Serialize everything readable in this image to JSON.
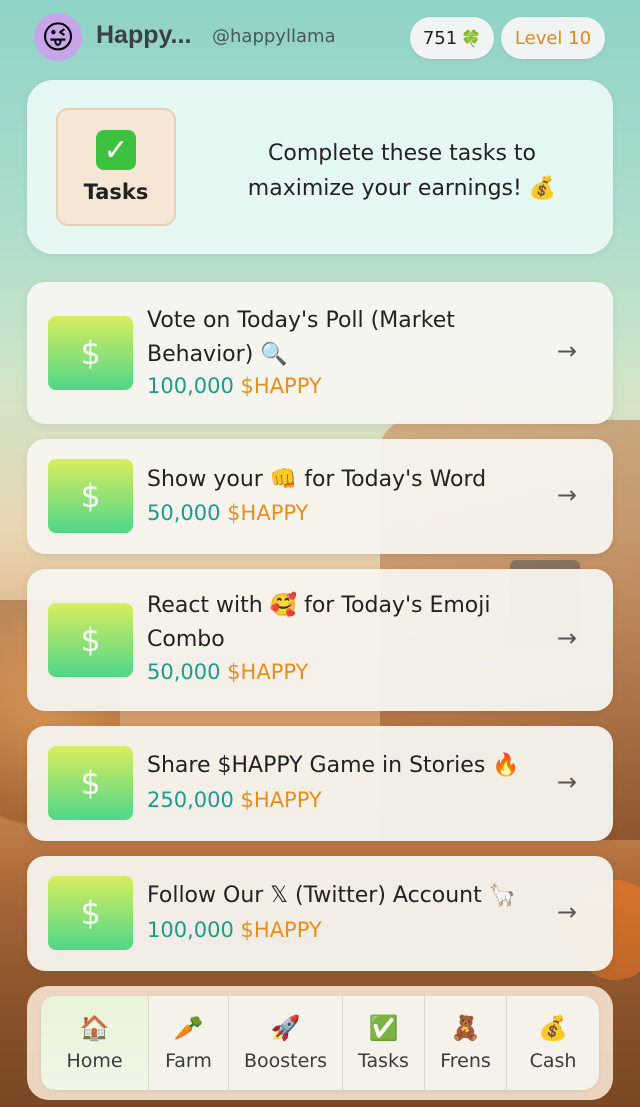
{
  "header": {
    "avatar": "😜",
    "user_name": "Happy...",
    "user_handle": "@happyllama",
    "score": "751",
    "score_icon": "🍀",
    "level": "Level 10"
  },
  "banner": {
    "badge_icon": "✓",
    "badge_label": "Tasks",
    "description": "Complete these tasks to maximize your earnings! 💰"
  },
  "tasks": [
    {
      "icon": "$",
      "title": "Vote on Today's Poll (Market Behavior) 🔍",
      "amount": "100,000",
      "currency": "$HAPPY"
    },
    {
      "icon": "$",
      "title": "Show your 👊 for Today's Word",
      "amount": "50,000",
      "currency": "$HAPPY"
    },
    {
      "icon": "$",
      "title": "React with 🥰 for Today's Emoji Combo",
      "amount": "50,000",
      "currency": "$HAPPY"
    },
    {
      "icon": "$",
      "title": "Share $HAPPY Game in Stories 🔥",
      "amount": "250,000",
      "currency": "$HAPPY"
    },
    {
      "icon": "$",
      "title": "Follow Our 𝕏 (Twitter) Account 🦙",
      "amount": "100,000",
      "currency": "$HAPPY"
    }
  ],
  "arrow": "→",
  "nav": [
    {
      "icon": "🏠",
      "label": "Home"
    },
    {
      "icon": "🥕",
      "label": "Farm"
    },
    {
      "icon": "🚀",
      "label": "Boosters"
    },
    {
      "icon": "✅",
      "label": "Tasks"
    },
    {
      "icon": "🧸",
      "label": "Frens"
    },
    {
      "icon": "💰",
      "label": "Cash"
    }
  ],
  "colors": {
    "reward_amount": "#1f9a8d",
    "reward_currency": "#e98e1a",
    "level": "#e08a1e",
    "task_icon_top": "#d8ee5e",
    "task_icon_bottom": "#4fd68a"
  }
}
